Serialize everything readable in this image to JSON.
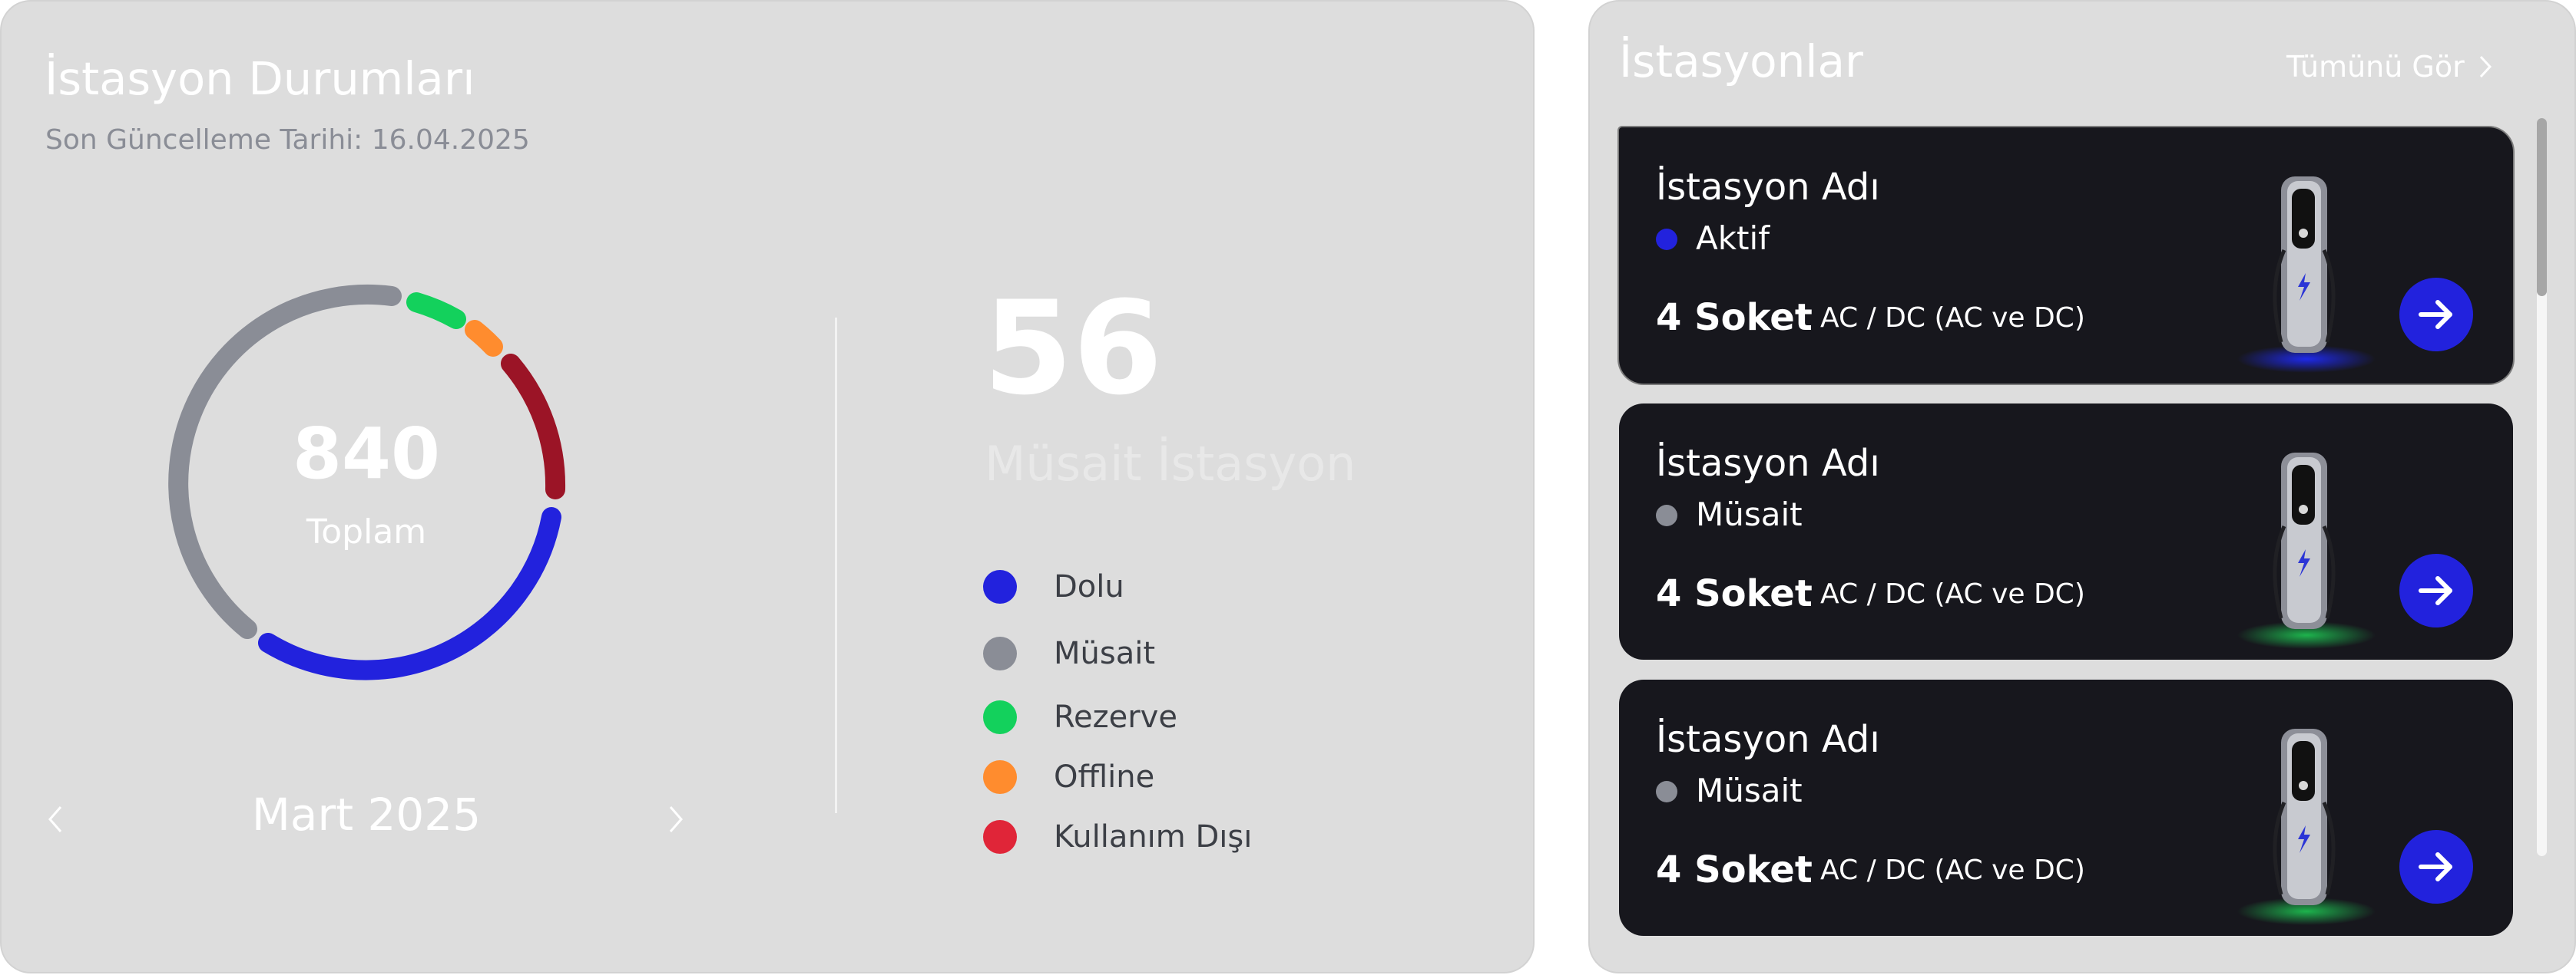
{
  "status_panel": {
    "title": "İstasyon Durumları",
    "last_update": "Son Güncelleme Tarihi: 16.04.2025",
    "total_value": "840",
    "total_label": "Toplam",
    "month": "Mart 2025",
    "available_count": "56",
    "available_label": "Müsait İstasyon",
    "legend": [
      {
        "label": "Dolu",
        "color": "#2222dd"
      },
      {
        "label": "Müsait",
        "color": "#8a8d96"
      },
      {
        "label": "Rezerve",
        "color": "#13d15c"
      },
      {
        "label": "Offline",
        "color": "#ff8c2e"
      },
      {
        "label": "Kullanım Dışı",
        "color": "#e02538"
      }
    ],
    "ring_colors": {
      "gray": "#8a8d96",
      "green": "#13d15c",
      "orange": "#ff8c2e",
      "red": "#9b1426",
      "blue": "#2222dd"
    },
    "icons": {
      "prev": "chevron-left-icon",
      "next": "chevron-right-icon"
    }
  },
  "stations_panel": {
    "title": "İstasyonlar",
    "see_all": "Tümünü Gör",
    "icons": {
      "see_all": "chevron-right-icon",
      "card_action": "arrow-right-icon",
      "charger": "ev-charger-image"
    },
    "cards": [
      {
        "name": "İstasyon Adı",
        "status": "Aktif",
        "status_color": "#2222dd",
        "glow_color": "#1f2bff",
        "sockets": "4 Soket",
        "type": "AC / DC (AC ve DC)",
        "selected": true
      },
      {
        "name": "İstasyon Adı",
        "status": "Müsait",
        "status_color": "#8a8d96",
        "glow_color": "#1ec552",
        "sockets": "4 Soket",
        "type": "AC / DC (AC ve DC)",
        "selected": false
      },
      {
        "name": "İstasyon Adı",
        "status": "Müsait",
        "status_color": "#8a8d96",
        "glow_color": "#1ec552",
        "sockets": "4 Soket",
        "type": "AC / DC (AC ve DC)",
        "selected": false
      }
    ]
  }
}
